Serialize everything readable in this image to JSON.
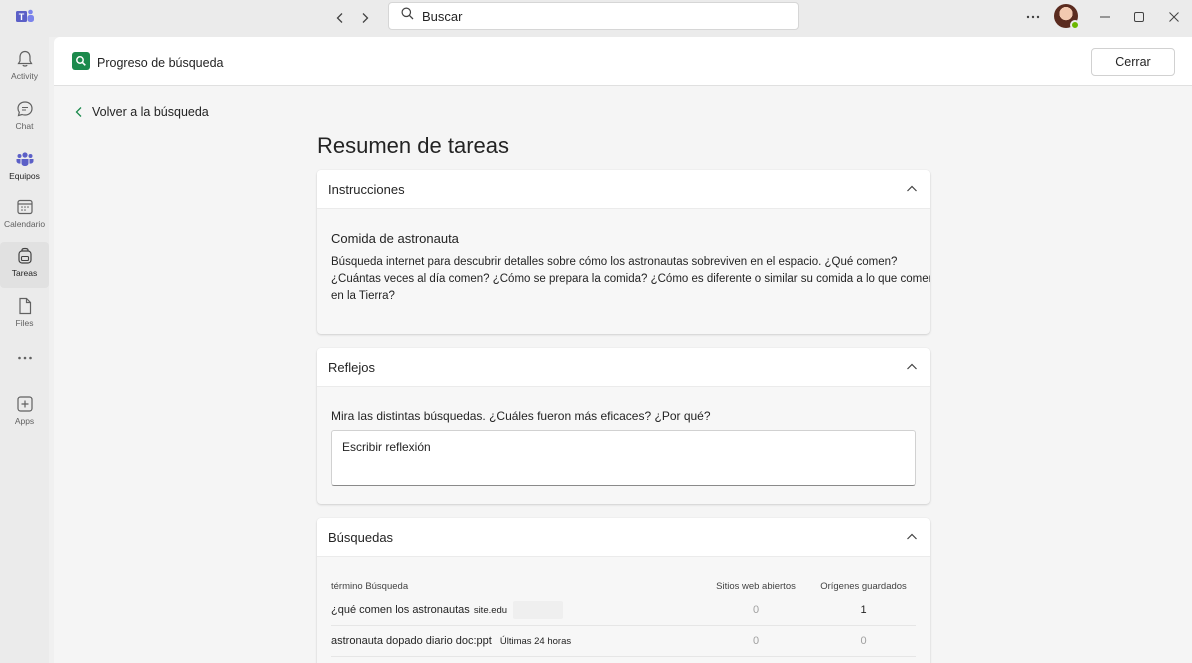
{
  "titlebar": {
    "search_placeholder": "Buscar"
  },
  "rail": {
    "items": [
      {
        "label": "Activity"
      },
      {
        "label": "Chat"
      },
      {
        "label": "Equipos"
      },
      {
        "label": "Calendario"
      },
      {
        "label": "Tareas"
      },
      {
        "label": "Files"
      },
      {
        "label": "Apps"
      }
    ]
  },
  "header": {
    "title": "Progreso de búsqueda",
    "close_label": "Cerrar"
  },
  "back_label": "Volver a la búsqueda",
  "page_title": "Resumen de tareas",
  "instructions": {
    "heading": "Instrucciones",
    "title": "Comida de astronauta",
    "text": "Búsqueda internet para descubrir detalles sobre cómo los astronautas sobreviven en el espacio. ¿Qué comen? ¿Cuántas veces al día comen? ¿Cómo se prepara la comida? ¿Cómo es diferente o similar su comida a lo que comen en la Tierra?"
  },
  "reflections": {
    "heading": "Reflejos",
    "question": "Mira las distintas búsquedas. ¿Cuáles fueron más eficaces? ¿Por qué?",
    "placeholder": "Escribir reflexión"
  },
  "searches": {
    "heading": "Búsquedas",
    "columns": [
      "término Búsqueda",
      "Sitios web abiertos",
      "Orígenes guardados"
    ],
    "rows": [
      {
        "term": "¿qué comen los astronautas",
        "tag": "site.edu",
        "sites": "0",
        "saved": "1"
      },
      {
        "term": "astronauta dopado diario doc:ppt",
        "tag": "Últimas 24 horas",
        "sites": "0",
        "saved": "0"
      }
    ]
  },
  "colors": {
    "accent": "#5b5fc7",
    "app_icon": "#1b8a4c",
    "status_available": "#6bb700"
  }
}
